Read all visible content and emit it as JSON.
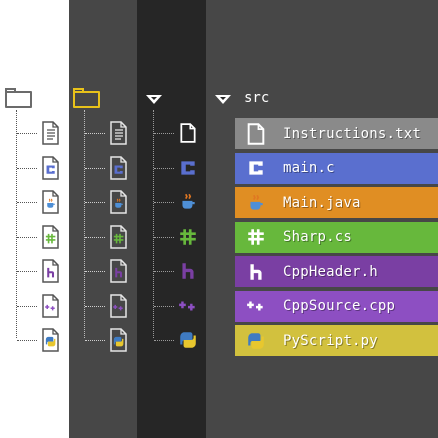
{
  "explorer": {
    "root_folder": {
      "name": "src"
    },
    "files": [
      {
        "name": "Instructions.txt",
        "type": "text",
        "icon": "blank-file-icon",
        "color": "#8a8a8a"
      },
      {
        "name": "main.c",
        "type": "c",
        "icon": "c-file-icon",
        "color": "#5a6fcf"
      },
      {
        "name": "Main.java",
        "type": "java",
        "icon": "java-file-icon",
        "color": "#e08e23"
      },
      {
        "name": "Sharp.cs",
        "type": "csharp",
        "icon": "csharp-file-icon",
        "color": "#67b83c"
      },
      {
        "name": "CppHeader.h",
        "type": "header",
        "icon": "h-file-icon",
        "color": "#7a3fa3"
      },
      {
        "name": "CppSource.cpp",
        "type": "cpp",
        "icon": "cpp-file-icon",
        "color": "#8d4fc2"
      },
      {
        "name": "PyScript.py",
        "type": "python",
        "icon": "python-file-icon",
        "color": "#d2c13e"
      }
    ],
    "columns": [
      {
        "theme": "light",
        "background": "#ffffff"
      },
      {
        "theme": "dark-gray",
        "background": "#474747"
      },
      {
        "theme": "near-black",
        "background": "#262626"
      },
      {
        "theme": "dark-gray-colored-rows",
        "background": "#474747"
      }
    ]
  }
}
